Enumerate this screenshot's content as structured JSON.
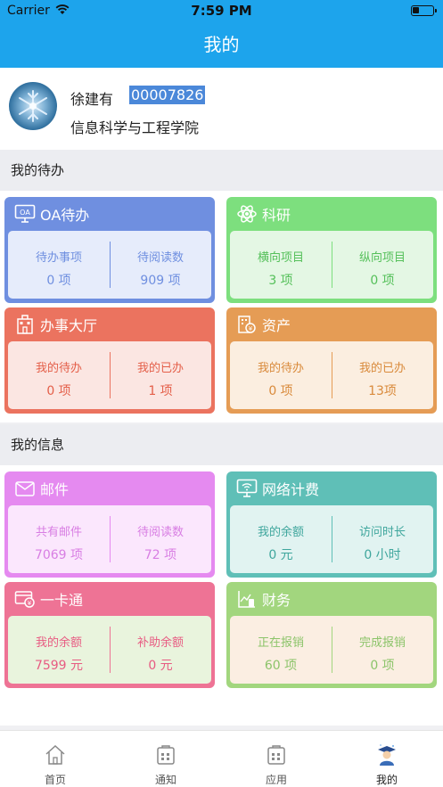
{
  "status_bar": {
    "carrier": "Carrier",
    "time": "7:59 PM"
  },
  "nav": {
    "title": "我的"
  },
  "profile": {
    "name": "徐建有",
    "id": "00007826",
    "department": "信息科学与工程学院"
  },
  "sections": {
    "todo": "我的待办",
    "info": "我的信息"
  },
  "cards": {
    "oa": {
      "title": "OA待办",
      "left_label": "待办事项",
      "left_value": "0 项",
      "right_label": "待阅读数",
      "right_value": "909 项"
    },
    "research": {
      "title": "科研",
      "left_label": "横向项目",
      "left_value": "3 项",
      "right_label": "纵向项目",
      "right_value": "0 项"
    },
    "hall": {
      "title": "办事大厅",
      "left_label": "我的待办",
      "left_value": "0 项",
      "right_label": "我的已办",
      "right_value": "1 项"
    },
    "assets": {
      "title": "资产",
      "left_label": "我的待办",
      "left_value": "0 项",
      "right_label": "我的已办",
      "right_value": "13项"
    },
    "mail": {
      "title": "邮件",
      "left_label": "共有邮件",
      "left_value": "7069 项",
      "right_label": "待阅读数",
      "right_value": "72 项"
    },
    "network": {
      "title": "网络计费",
      "left_label": "我的余额",
      "left_value": "0 元",
      "right_label": "访问时长",
      "right_value": "0 小时"
    },
    "card": {
      "title": "一卡通",
      "left_label": "我的余额",
      "left_value": "7599 元",
      "right_label": "补助余额",
      "right_value": "0 元"
    },
    "finance": {
      "title": "财务",
      "left_label": "正在报销",
      "left_value": "60 项",
      "right_label": "完成报销",
      "right_value": "0 项"
    }
  },
  "tabs": [
    {
      "label": "首页",
      "icon": "home-icon"
    },
    {
      "label": "通知",
      "icon": "notice-icon"
    },
    {
      "label": "应用",
      "icon": "apps-icon"
    },
    {
      "label": "我的",
      "icon": "profile-graduate-icon"
    }
  ],
  "colors": {
    "primary": "#1da4ec",
    "oa": "#6f8fe0",
    "research": "#7ddf7e",
    "hall": "#eb735f",
    "assets": "#e59c55",
    "mail": "#e58af0",
    "network": "#5fbfb7",
    "card": "#ee7395",
    "finance": "#a2d67e"
  }
}
